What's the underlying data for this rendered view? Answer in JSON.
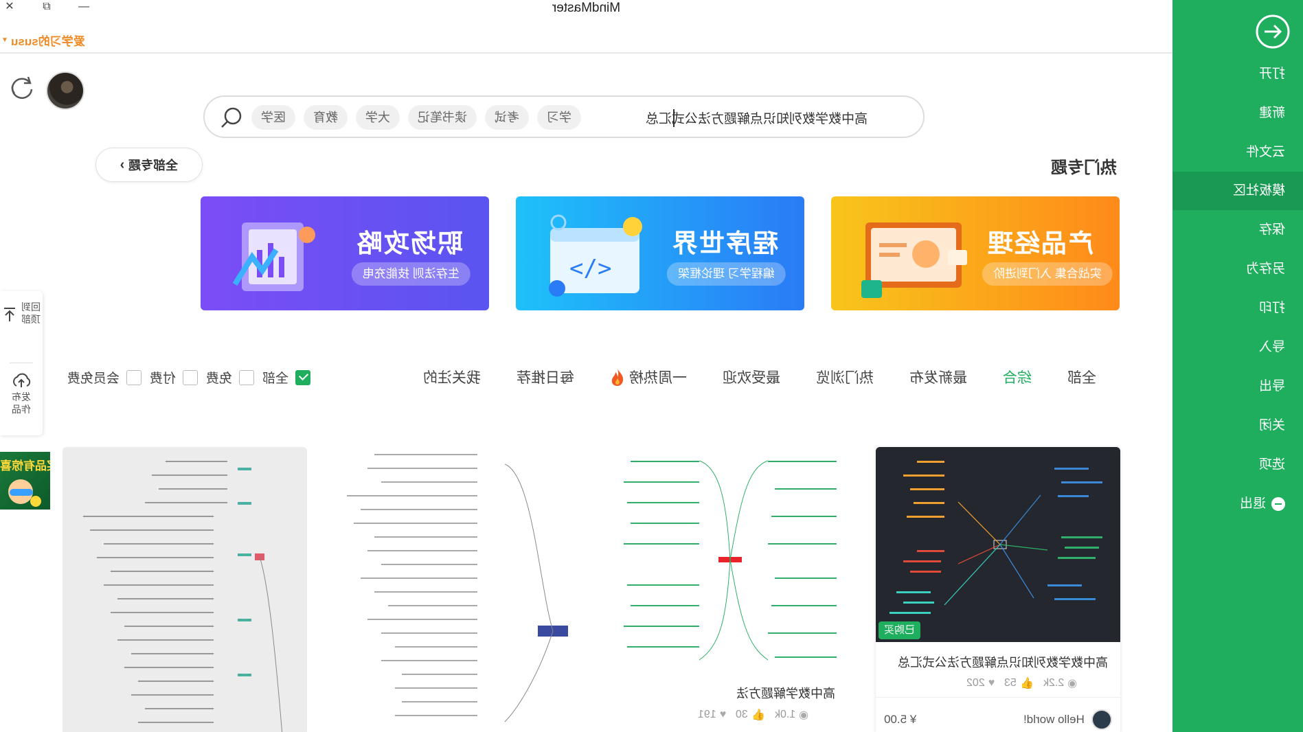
{
  "window": {
    "title": "MindMaster",
    "close": "✕",
    "restore": "⧉",
    "minimize": "—"
  },
  "user": {
    "name": "爱学习的susu"
  },
  "search": {
    "value": "高中数学数列知识点解题方法公式汇总",
    "tags": [
      "医学",
      "教育",
      "大学",
      "读书笔记",
      "考试",
      "学习"
    ]
  },
  "section": {
    "title": "热门专题",
    "back_label": "全部专题"
  },
  "banners": [
    {
      "title": "职场攻略",
      "subtitle": "生存法则 技能充电"
    },
    {
      "title": "程序世界",
      "subtitle": "编程学习 理论框架"
    },
    {
      "title": "产品经理",
      "subtitle": "实战合集 入门到进阶"
    }
  ],
  "float_panel": {
    "top": "回到顶部",
    "publish": "发布作品"
  },
  "filters": {
    "checkboxes": [
      {
        "label": "全部",
        "checked": true
      },
      {
        "label": "免费",
        "checked": false
      },
      {
        "label": "付费",
        "checked": false
      },
      {
        "label": "会员免费",
        "checked": false
      }
    ],
    "sort_tabs": [
      {
        "label": "我关注的",
        "active": false
      },
      {
        "label": "每日推荐",
        "active": false
      },
      {
        "label": "一周热榜",
        "active": false,
        "icon": "flame-icon"
      },
      {
        "label": "最受欢迎",
        "active": false
      },
      {
        "label": "热门浏览",
        "active": false
      },
      {
        "label": "最新发布",
        "active": false
      },
      {
        "label": "综合",
        "active": true
      },
      {
        "label": "全部",
        "active": false
      }
    ]
  },
  "cards": [
    {
      "title": "高中数学数列知识点解题方法公式汇总",
      "badge": "已购买",
      "views": "2.2k",
      "likes": "53",
      "favs": "202",
      "author": "Hello world!",
      "price": "¥ 5.00"
    },
    {
      "title": "高中数学解题方法",
      "views": "1.0k",
      "likes": "30",
      "favs": "191"
    }
  ],
  "promo": {
    "text": "奖品有惊喜"
  },
  "sidebar": {
    "items": [
      "打开",
      "新建",
      "云文件",
      "模板社区",
      "保存",
      "另存为",
      "打印",
      "导入",
      "导出",
      "关闭",
      "选项",
      "退出"
    ],
    "active_index": 3
  },
  "colors": {
    "brand": "#1fad5e",
    "accent_orange": "#f08a24"
  }
}
